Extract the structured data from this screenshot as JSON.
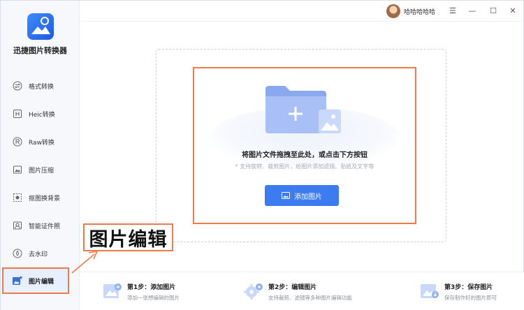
{
  "app": {
    "name": "迅捷图片转换器"
  },
  "user": {
    "name": "哈哈哈哈哈"
  },
  "window_controls": {
    "menu": "☰",
    "minimize": "—",
    "maximize": "☐",
    "close": "✕"
  },
  "sidebar": {
    "items": [
      {
        "label": "格式转换",
        "icon": "convert-icon"
      },
      {
        "label": "Heic转换",
        "icon": "heic-icon"
      },
      {
        "label": "Raw转换",
        "icon": "raw-icon"
      },
      {
        "label": "图片压缩",
        "icon": "compress-icon"
      },
      {
        "label": "抠图换背景",
        "icon": "cutout-icon"
      },
      {
        "label": "智能证件照",
        "icon": "id-photo-icon"
      },
      {
        "label": "去水印",
        "icon": "watermark-icon"
      },
      {
        "label": "图片编辑",
        "icon": "image-edit-icon",
        "active": true
      }
    ]
  },
  "dropzone": {
    "title": "将图片文件拖拽至此处，或点击下方按钮",
    "subtitle": "* 支持旋转、裁剪图片，给图片添加滤镜、贴纸及文字等",
    "button": "添加图片"
  },
  "callout": {
    "text": "图片编辑"
  },
  "steps": [
    {
      "title": "第1步：添加图片",
      "desc": "添加一张想编辑的图片"
    },
    {
      "title": "第2步：编辑图片",
      "desc": "支持裁剪、滤镜等多种图片编辑功能"
    },
    {
      "title": "第3步：保存图片",
      "desc": "保存制作好的图片即可"
    }
  ],
  "colors": {
    "accent": "#3d7bf0",
    "highlight": "#f07a4a",
    "sidebar_bg": "#f6f8fb"
  }
}
